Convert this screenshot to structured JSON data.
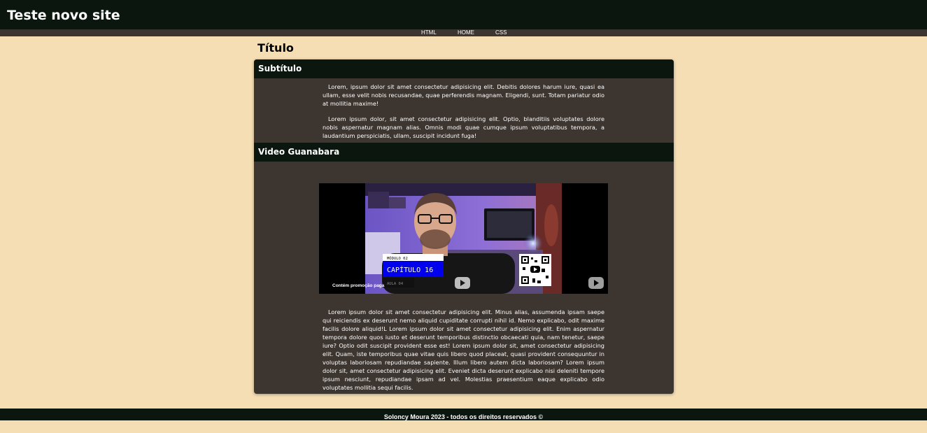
{
  "header": {
    "site_title": "Teste novo site"
  },
  "nav": {
    "items": [
      "HTML",
      "HOME",
      "CSS"
    ]
  },
  "main": {
    "title": "Título",
    "sections": [
      {
        "heading": "Subtítulo",
        "paragraphs": [
          "Lorem, ipsum dolor sit amet consectetur adipisicing elit. Debitis dolores harum iure, quasi ea ullam, esse velit nobis recusandae, quae perferendis magnam. Eligendi, sunt. Totam pariatur odio at mollitia maxime!",
          "Lorem ipsum dolor, sit amet consectetur adipisicing elit. Optio, blanditiis voluptates dolore nobis aspernatur magnam alias. Omnis modi quae cumque ipsum voluptatibus tempora, a laudantium perspiciatis, ullam, suscipit incidunt fuga!"
        ]
      },
      {
        "heading": "Video Guanabara",
        "video": {
          "module_label": "MÓDULO 02",
          "chapter_label": "CAPÍTULO 16",
          "lesson_label": "AULA 04",
          "promo_text": "Contém promoção paga",
          "colors": {
            "chapter_bg": "#0000ee",
            "wall": "#7b63c9",
            "shirt": "#1a1a1a"
          }
        },
        "paragraph": "Lorem ipsum dolor sit amet consectetur adipisicing elit. Minus alias, assumenda ipsam saepe qui reiciendis ex deserunt nemo aliquid cupiditate corrupti nihil id. Nemo explicabo, odit maxime facilis dolore aliquid!L Lorem ipsum dolor sit amet consectetur adipisicing elit. Enim aspernatur tempora dolore quos iusto et deserunt temporibus distinctio obcaecati quia, nam tenetur, saepe iure? Optio odit suscipit provident esse est! Lorem ipsum dolor sit, amet consectetur adipisicing elit. Quam, iste temporibus quae vitae quis libero quod placeat, quasi provident consequuntur in voluptas laboriosam repudiandae sapiente. Illum libero autem dicta laboriosam? Lorem ipsum dolor sit, amet consectetur adipisicing elit. Eveniet dicta deserunt explicabo nisi deleniti tempore ipsum nesciunt, repudiandae ipsam ad vel. Molestias praesentium eaque explicabo odio voluptates mollitia sequi facilis."
      }
    ]
  },
  "footer": {
    "text": "Soloncy Moura 2023 - todos os direitos reservados ©"
  },
  "colors": {
    "page_bg": "#f5deb3",
    "header_bg": "#0b160f",
    "card_bg": "#3d3530"
  }
}
